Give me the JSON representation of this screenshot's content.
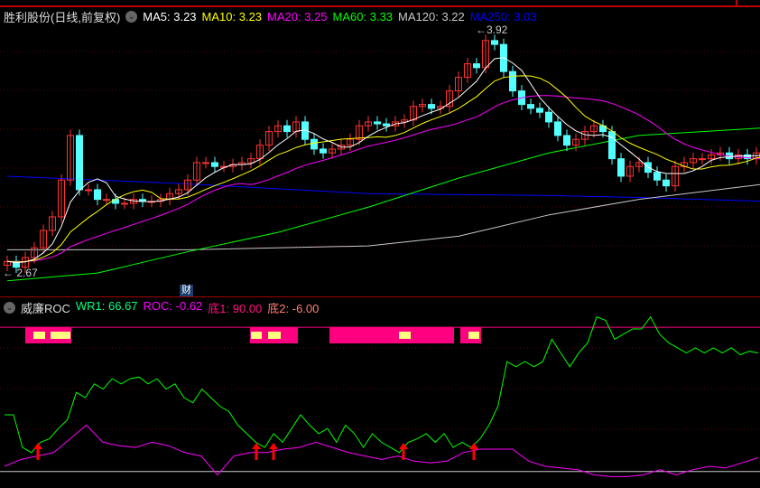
{
  "title": "胜利股份(日线,前复权)",
  "ma_labels": [
    {
      "text": "MA5: 3.23",
      "color": "#ffffff"
    },
    {
      "text": "MA10: 3.23",
      "color": "#ffff00"
    },
    {
      "text": "MA20: 3.25",
      "color": "#ff00ff"
    },
    {
      "text": "MA60: 3.33",
      "color": "#00ff00"
    },
    {
      "text": "MA120: 3.22",
      "color": "#c8c8c8"
    },
    {
      "text": "MA250: 3.03",
      "color": "#0000ff"
    }
  ],
  "indicator_name": "威廉ROC",
  "indicator_labels": [
    {
      "text": "WR1: 66.67",
      "color": "#00ff80"
    },
    {
      "text": "ROC: -0.62",
      "color": "#ff00ff"
    },
    {
      "text": "底1: 90.00",
      "color": "#ff1080"
    },
    {
      "text": "底2: -6.00",
      "color": "#ff8070"
    }
  ],
  "event_badge": "财",
  "high_label": "3.92",
  "low_label": "2.67",
  "colors": {
    "up": "#ff3232",
    "down": "#54ffff",
    "ma5": "#ffffff",
    "ma10": "#ffff00",
    "ma20": "#ff00ff",
    "ma60": "#00ff00",
    "ma120": "#c8c8c8",
    "ma250": "#0000ff",
    "band": "#ff0080",
    "band_mark": "#ffff80",
    "wr": "#00ff00",
    "roc": "#ff00ff",
    "arrow": "#ff0000"
  },
  "chart_data": [
    {
      "type": "candlestick",
      "price_range": [
        2.67,
        3.92
      ],
      "closes": [
        2.72,
        2.69,
        2.74,
        2.79,
        2.88,
        2.95,
        3.14,
        3.37,
        3.09,
        3.09,
        3.04,
        3.04,
        3.02,
        3.02,
        3.04,
        3.03,
        3.03,
        3.04,
        3.07,
        3.09,
        3.14,
        3.23,
        3.23,
        3.21,
        3.21,
        3.22,
        3.23,
        3.25,
        3.32,
        3.39,
        3.42,
        3.39,
        3.44,
        3.35,
        3.3,
        3.28,
        3.3,
        3.32,
        3.35,
        3.42,
        3.44,
        3.43,
        3.42,
        3.44,
        3.45,
        3.52,
        3.53,
        3.51,
        3.52,
        3.6,
        3.67,
        3.74,
        3.72,
        3.86,
        3.84,
        3.7,
        3.6,
        3.53,
        3.51,
        3.49,
        3.44,
        3.37,
        3.32,
        3.35,
        3.39,
        3.42,
        3.39,
        3.25,
        3.16,
        3.21,
        3.23,
        3.18,
        3.14,
        3.11,
        3.21,
        3.23,
        3.25,
        3.25,
        3.27,
        3.28,
        3.25,
        3.27,
        3.25,
        3.28,
        3.29
      ],
      "ma60": [
        [
          0,
          2.62
        ],
        [
          10,
          2.66
        ],
        [
          20,
          2.77
        ],
        [
          30,
          2.87
        ],
        [
          40,
          3.0
        ],
        [
          50,
          3.15
        ],
        [
          60,
          3.28
        ],
        [
          70,
          3.37
        ],
        [
          84,
          3.41
        ]
      ],
      "ma120": [
        [
          0,
          2.78
        ],
        [
          20,
          2.78
        ],
        [
          40,
          2.8
        ],
        [
          50,
          2.85
        ],
        [
          60,
          2.96
        ],
        [
          70,
          3.04
        ],
        [
          84,
          3.12
        ]
      ],
      "ma250": [
        [
          0,
          3.16
        ],
        [
          20,
          3.12
        ],
        [
          40,
          3.07
        ],
        [
          60,
          3.06
        ],
        [
          70,
          3.05
        ],
        [
          84,
          3.03
        ]
      ]
    },
    {
      "type": "line",
      "yrange": [
        0,
        100
      ],
      "levels": [
        91,
        7
      ],
      "wr": [
        40,
        40,
        21,
        18,
        24,
        26,
        32,
        37,
        53,
        50,
        58,
        55,
        61,
        58,
        61,
        62,
        58,
        61,
        55,
        58,
        50,
        47,
        55,
        50,
        45,
        42,
        34,
        29,
        24,
        21,
        29,
        24,
        32,
        40,
        34,
        29,
        32,
        24,
        34,
        29,
        21,
        29,
        24,
        21,
        18,
        24,
        26,
        29,
        24,
        29,
        21,
        24,
        21,
        26,
        34,
        45,
        71,
        68,
        71,
        68,
        71,
        84,
        76,
        68,
        76,
        82,
        97,
        95,
        84,
        87,
        90,
        90,
        97,
        87,
        82,
        79,
        76,
        79,
        76,
        79,
        76,
        79,
        75,
        77,
        76
      ],
      "roc": [
        10,
        14,
        16,
        18,
        26,
        34,
        24,
        22,
        21,
        24,
        22,
        18,
        16,
        5,
        16,
        18,
        18,
        20,
        21,
        24,
        21,
        18,
        16,
        14,
        16,
        13,
        12,
        13,
        18,
        20,
        20,
        20,
        13,
        10,
        9,
        8,
        5,
        4,
        4,
        5,
        8,
        5,
        8,
        10,
        9,
        12,
        15
      ],
      "bands": [
        [
          2.5,
          7.6
        ],
        [
          27.4,
          32.7
        ],
        [
          36.2,
          50
        ],
        [
          50.7,
          53
        ]
      ],
      "band_marks": [
        [
          3.4,
          4.7
        ],
        [
          5.3,
          7.5
        ],
        [
          27.5,
          28.7
        ],
        [
          29.4,
          30.8
        ],
        [
          43.9,
          45.2
        ],
        [
          51.6,
          52.8
        ]
      ],
      "arrows": [
        3.9,
        28.1,
        30,
        44.4,
        52.2
      ]
    }
  ]
}
